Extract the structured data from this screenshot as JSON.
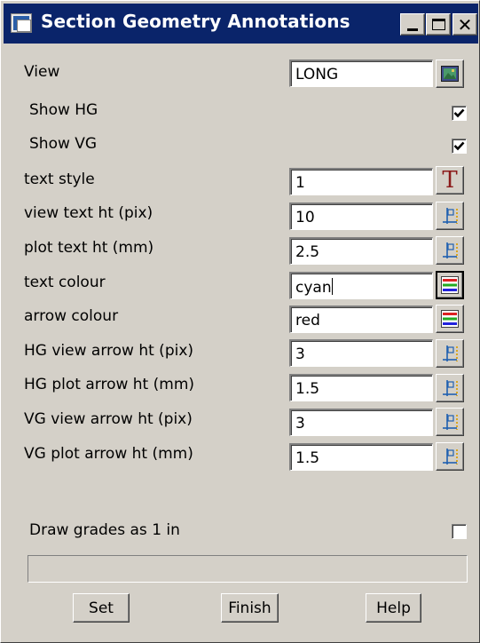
{
  "window": {
    "title": "Section Geometry Annotations",
    "close_glyph": "✕"
  },
  "fields": {
    "view": {
      "label": "View",
      "value": "LONG",
      "icon": "view-picker-icon"
    },
    "show_hg": {
      "label": "Show HG",
      "checked": true
    },
    "show_vg": {
      "label": "Show VG",
      "checked": true
    },
    "text_style": {
      "label": "text style",
      "value": "1",
      "icon": "text-style-icon",
      "icon_glyph": "T"
    },
    "view_text_ht": {
      "label": "view text ht (pix)",
      "value": "10",
      "icon": "calc-icon"
    },
    "plot_text_ht": {
      "label": "plot text ht (mm)",
      "value": "2.5",
      "icon": "calc-icon"
    },
    "text_colour": {
      "label": "text colour",
      "value": "cyan",
      "icon": "colour-picker-icon"
    },
    "arrow_colour": {
      "label": "arrow colour",
      "value": "red",
      "icon": "colour-picker-icon"
    },
    "hg_view_arrow_ht": {
      "label": "HG view arrow ht (pix)",
      "value": "3",
      "icon": "calc-icon"
    },
    "hg_plot_arrow_ht": {
      "label": "HG plot arrow ht (mm)",
      "value": "1.5",
      "icon": "calc-icon"
    },
    "vg_view_arrow_ht": {
      "label": "VG view arrow ht (pix)",
      "value": "3",
      "icon": "calc-icon"
    },
    "vg_plot_arrow_ht": {
      "label": "VG plot arrow ht (mm)",
      "value": "1.5",
      "icon": "calc-icon"
    },
    "draw_grades": {
      "label": "Draw grades as 1 in",
      "checked": false
    }
  },
  "status_text": "",
  "buttons": {
    "set": "Set",
    "finish": "Finish",
    "help": "Help"
  },
  "colors": {
    "titlebar": "#0a246a",
    "face": "#d4d0c8",
    "text_style_icon": "#8b1a1a",
    "calc_icon": "#1f5fb0"
  }
}
